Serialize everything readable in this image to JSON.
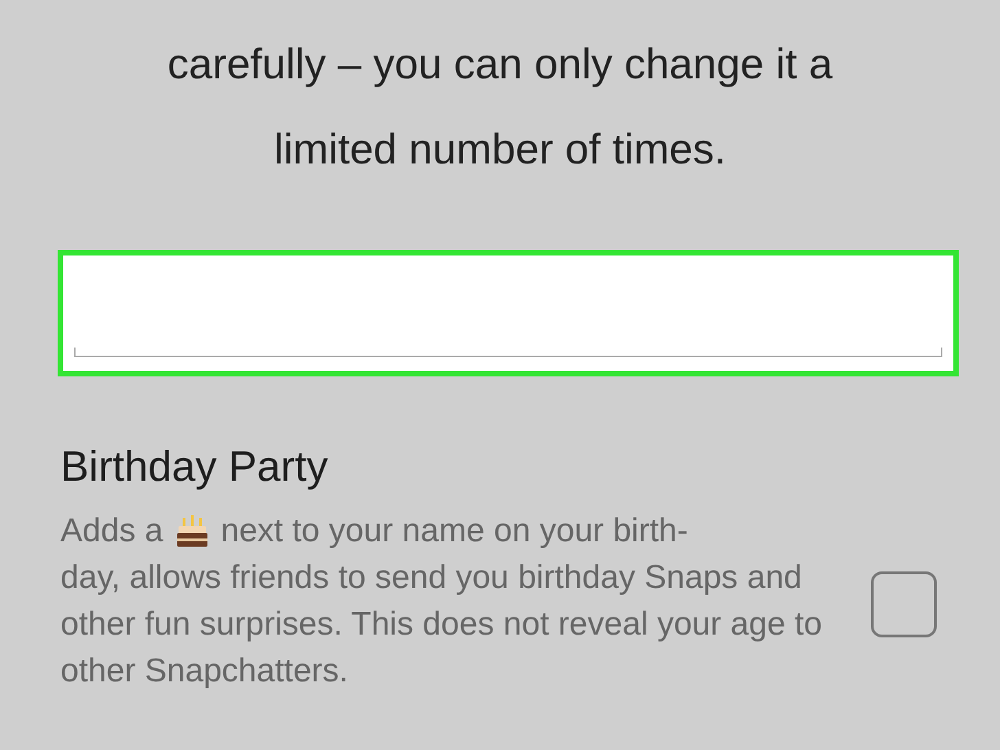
{
  "intro": "carefully – you can only change it a limited number of times.",
  "birthday_field": {
    "highlighted": true
  },
  "birthday_party": {
    "title": "Birthday Party",
    "description_before": "Adds a",
    "description_first_line": "next to your name on your birth-",
    "description_rest": "day, allows friends to send you birthday Snaps and other fun surprises. This does not reveal your age to other Snapchatters.",
    "checked": false
  }
}
